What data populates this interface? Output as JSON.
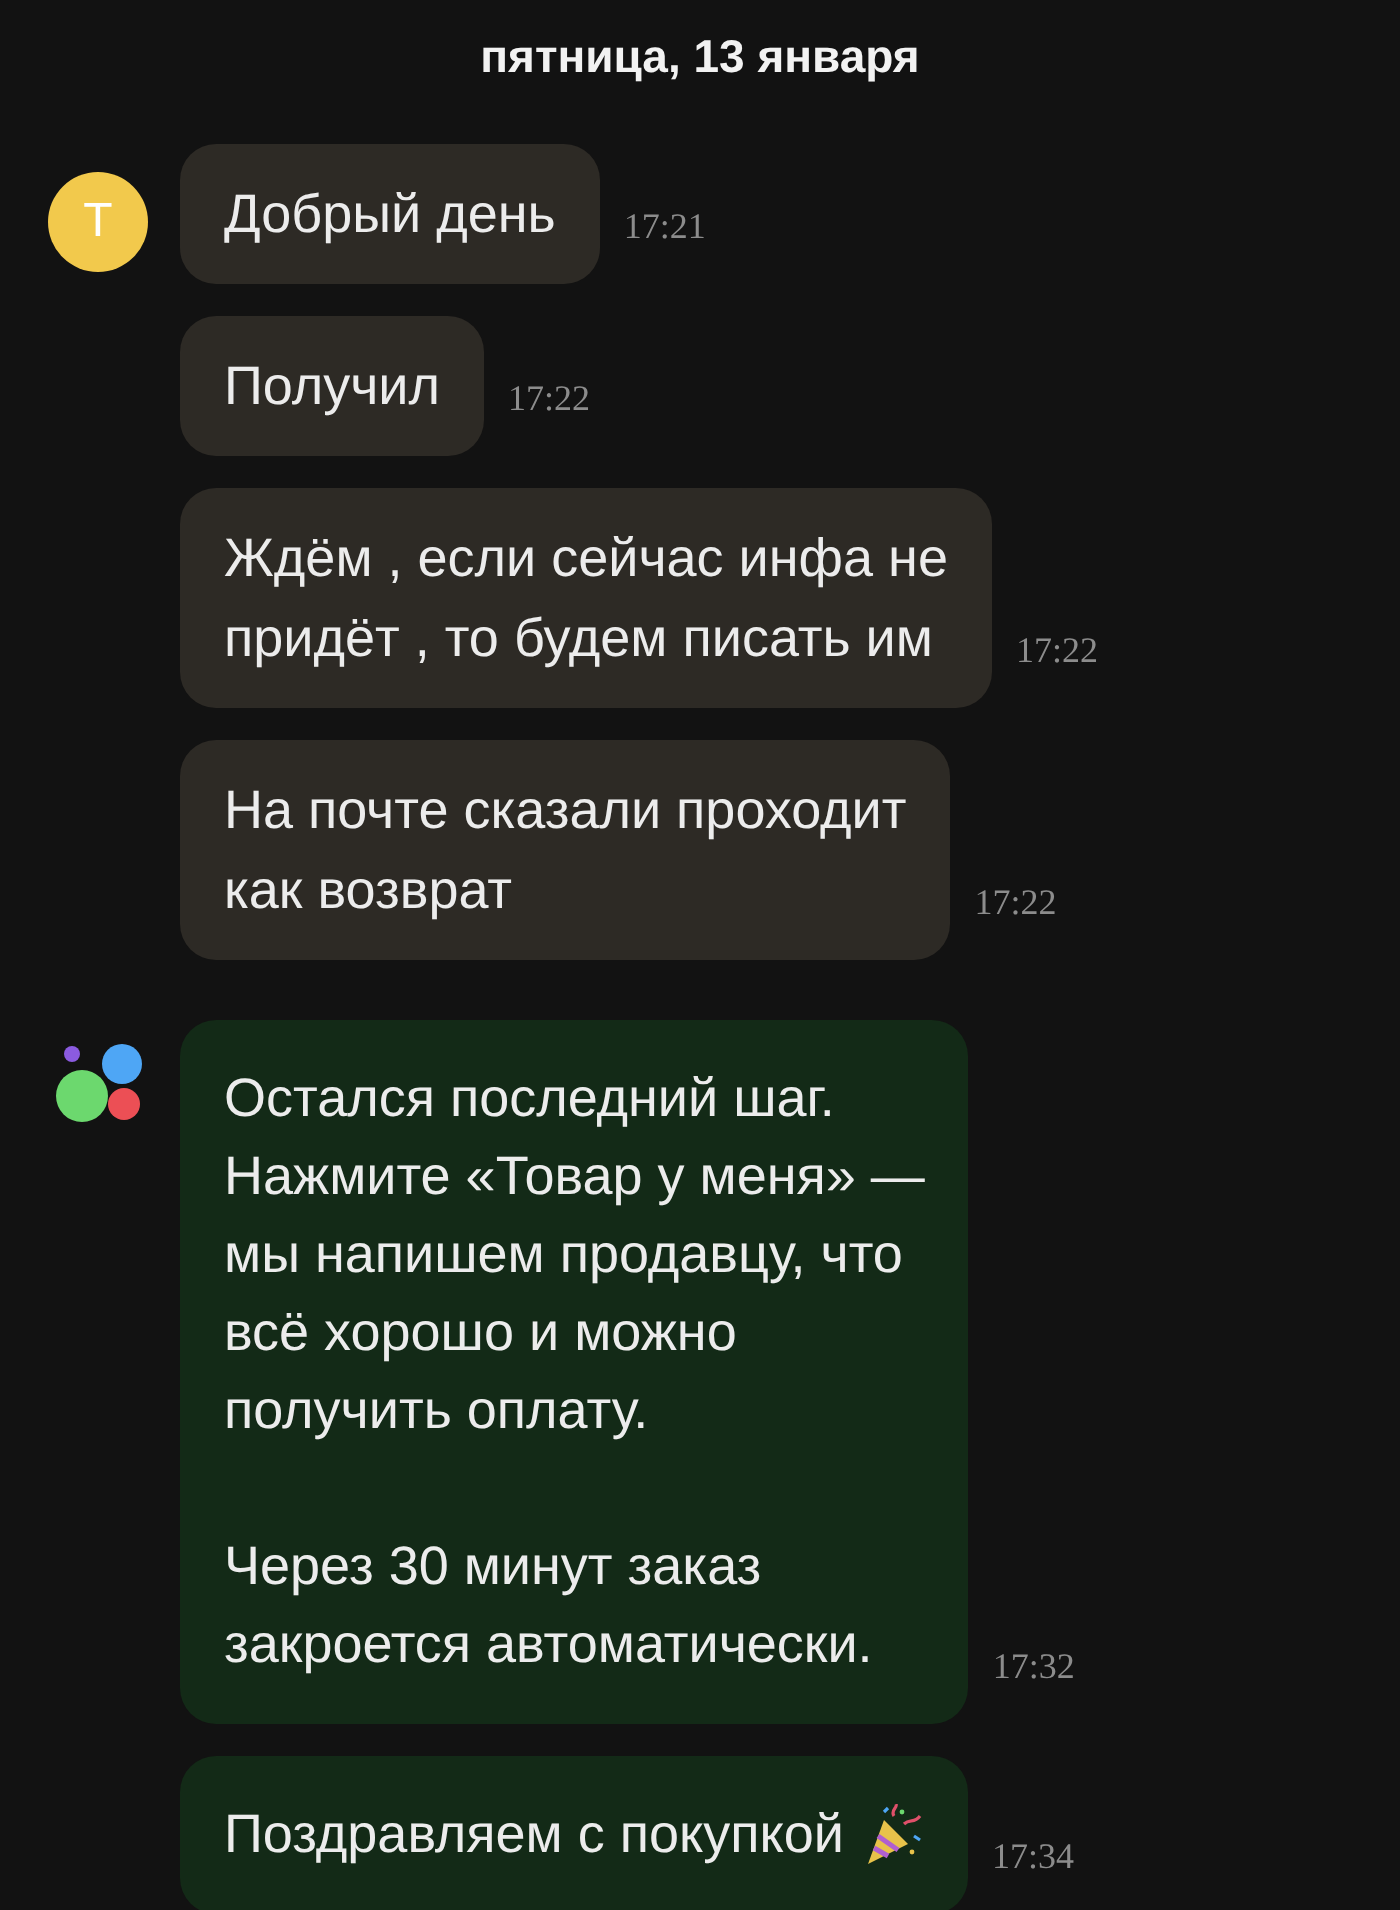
{
  "date_header": "пятница, 13 января",
  "groups": [
    {
      "kind": "user",
      "avatar": {
        "kind": "letter",
        "letter": "Т"
      },
      "messages": [
        {
          "text": "Добрый день",
          "time": "17:21",
          "trailing_icon": false
        },
        {
          "text": "Получил",
          "time": "17:22",
          "trailing_icon": false
        },
        {
          "text": "Ждём , если сейчас инфа не\nпридёт , то будем писать им",
          "time": "17:22",
          "trailing_icon": false
        },
        {
          "text": "На почте сказали проходит\nкак возврат",
          "time": "17:22",
          "trailing_icon": false
        }
      ]
    },
    {
      "kind": "bot",
      "avatar": {
        "kind": "logo"
      },
      "messages": [
        {
          "text": "Остался последний шаг.\nНажмите «Товар у меня» —\nмы напишем продавцу, что\nвсё хорошо и можно\nполучить оплату.\n\nЧерез 30 минут заказ\nзакроется автоматически.",
          "time": "17:32",
          "trailing_icon": false
        },
        {
          "text": "Поздравляем с покупкой",
          "time": "17:34",
          "trailing_icon": true
        }
      ]
    }
  ]
}
